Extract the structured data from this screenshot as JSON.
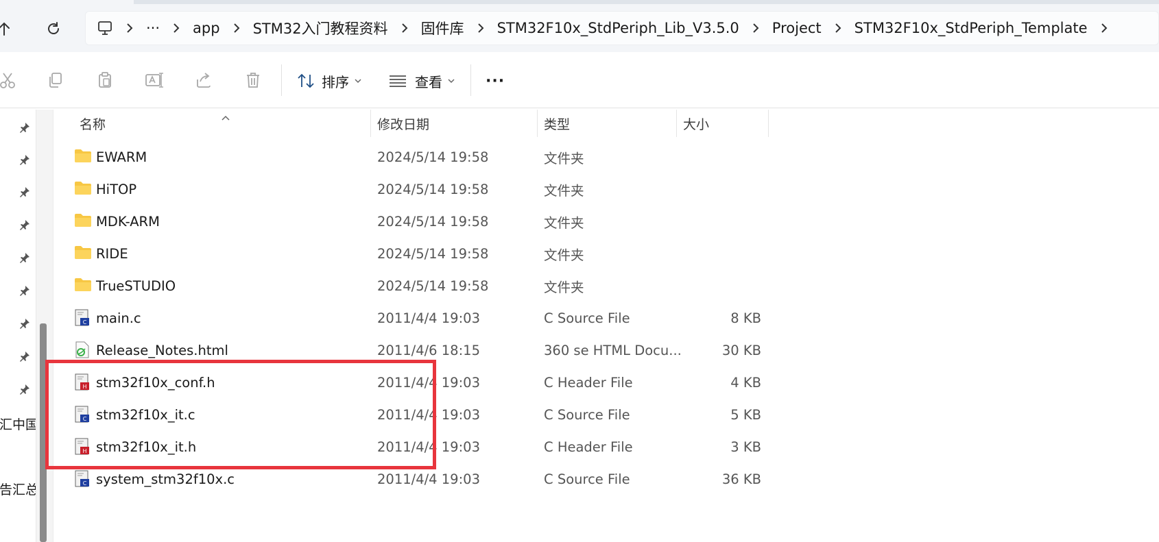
{
  "address_bar": {
    "crumbs": [
      "app",
      "STM32入门教程资料",
      "固件库",
      "STM32F10x_StdPeriph_Lib_V3.5.0",
      "Project",
      "STM32F10x_StdPeriph_Template"
    ],
    "overflow_label": "···"
  },
  "toolbar": {
    "sort_label": "排序",
    "view_label": "查看",
    "more_label": "···"
  },
  "nav_pane": {
    "labels": [
      "据汇中国",
      "告汇总"
    ]
  },
  "columns": {
    "name": "名称",
    "date": "修改日期",
    "type": "类型",
    "size": "大小"
  },
  "files": [
    {
      "name": "EWARM",
      "date": "2024/5/14 19:58",
      "type": "文件夹",
      "size": "",
      "icon": "folder-icon"
    },
    {
      "name": "HiTOP",
      "date": "2024/5/14 19:58",
      "type": "文件夹",
      "size": "",
      "icon": "folder-icon"
    },
    {
      "name": "MDK-ARM",
      "date": "2024/5/14 19:58",
      "type": "文件夹",
      "size": "",
      "icon": "folder-icon"
    },
    {
      "name": "RIDE",
      "date": "2024/5/14 19:58",
      "type": "文件夹",
      "size": "",
      "icon": "folder-icon"
    },
    {
      "name": "TrueSTUDIO",
      "date": "2024/5/14 19:58",
      "type": "文件夹",
      "size": "",
      "icon": "folder-icon"
    },
    {
      "name": "main.c",
      "date": "2011/4/4 19:03",
      "type": "C Source File",
      "size": "8 KB",
      "icon": "c-source-file-icon"
    },
    {
      "name": "Release_Notes.html",
      "date": "2011/4/6 18:15",
      "type": "360 se HTML Docu...",
      "size": "30 KB",
      "icon": "html-file-icon"
    },
    {
      "name": "stm32f10x_conf.h",
      "date": "2011/4/4 19:03",
      "type": "C Header File",
      "size": "4 KB",
      "icon": "c-header-file-icon"
    },
    {
      "name": "stm32f10x_it.c",
      "date": "2011/4/4 19:03",
      "type": "C Source File",
      "size": "5 KB",
      "icon": "c-source-file-icon"
    },
    {
      "name": "stm32f10x_it.h",
      "date": "2011/4/4 19:03",
      "type": "C Header File",
      "size": "3 KB",
      "icon": "c-header-file-icon"
    },
    {
      "name": "system_stm32f10x.c",
      "date": "2011/4/4 19:03",
      "type": "C Source File",
      "size": "36 KB",
      "icon": "c-source-file-icon"
    }
  ],
  "colors": {
    "highlight": "#e8353d",
    "folder": "#f7c744",
    "c_source": "#1f3fa0",
    "c_header": "#c8202c"
  }
}
